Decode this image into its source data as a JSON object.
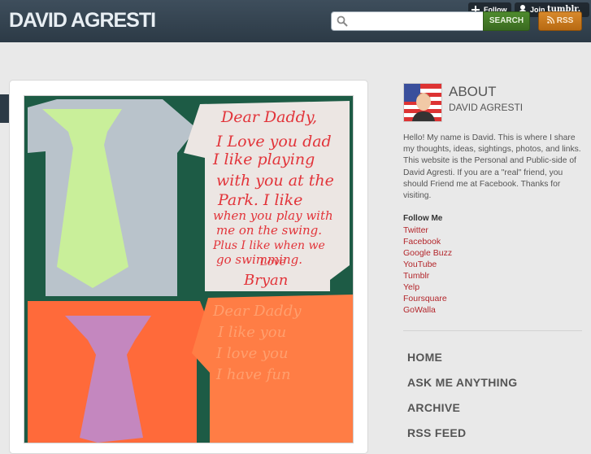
{
  "header": {
    "site_title": "DAVID AGRESTI",
    "search_placeholder": "",
    "search_button": "SEARCH",
    "rss_button": "RSS"
  },
  "tumblr": {
    "follow_label": "Follow",
    "join_label": "Join",
    "brand": "tumblr."
  },
  "sidebar": {
    "about_title": "ABOUT",
    "about_name": "DAVID AGRESTI",
    "about_text": "Hello! My name is David. This is where I share my thoughts, ideas, sightings, photos, and links. This website is the Personal and Public-side of David Agresti. If you are a \"real\" friend, you should Friend me at Facebook. Thanks for visiting.",
    "follow_heading": "Follow Me",
    "follow_links": [
      "Twitter",
      "Facebook",
      "Google Buzz",
      "YouTube",
      "Tumblr",
      "Yelp",
      "Foursquare",
      "GoWalla"
    ],
    "nav": [
      "HOME",
      "ASK ME ANYTHING",
      "ARCHIVE",
      "RSS FEED"
    ]
  },
  "photo": {
    "card1_text": [
      "Dear Daddy,",
      "I Love you dad",
      "I like playing",
      "with you at the",
      "Park. I like",
      "when you play with",
      "me on the swing.",
      "Plus I like when we",
      "go swimming.",
      "Love",
      "Bryan"
    ],
    "card2_text": [
      "Dear Daddy",
      "I like you",
      "I love you",
      "I have fun"
    ]
  },
  "colors": {
    "header_bg": "#34434f",
    "link_red": "#b3262b",
    "search_green": "#447a26",
    "rss_orange": "#c97a1e"
  }
}
